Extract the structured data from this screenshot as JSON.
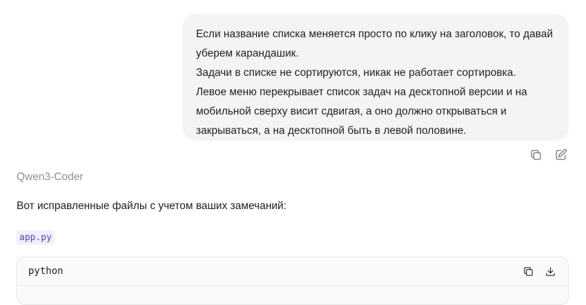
{
  "user_message": {
    "lines": [
      "Если название списка меняется просто по клику на заголовок, то давай",
      "уберем карандашик.",
      "Задачи в списке не сортируются, никак не работает сортировка.",
      "Левое меню перекрывает список задач на десктопной версии и на",
      "мобильной сверху висит сдвигая, а оно должно открываться и",
      "закрываться, а на десктопной быть в левой половине."
    ],
    "actions": [
      {
        "name": "copy-icon"
      },
      {
        "name": "edit-icon"
      }
    ]
  },
  "assistant": {
    "model_name": "Qwen3-Coder",
    "intro_text": "Вот исправленные файлы с учетом ваших замечаний:",
    "file_name": "app.py",
    "code_block": {
      "language": "python",
      "actions": [
        {
          "name": "copy-icon"
        },
        {
          "name": "download-icon"
        }
      ]
    }
  }
}
